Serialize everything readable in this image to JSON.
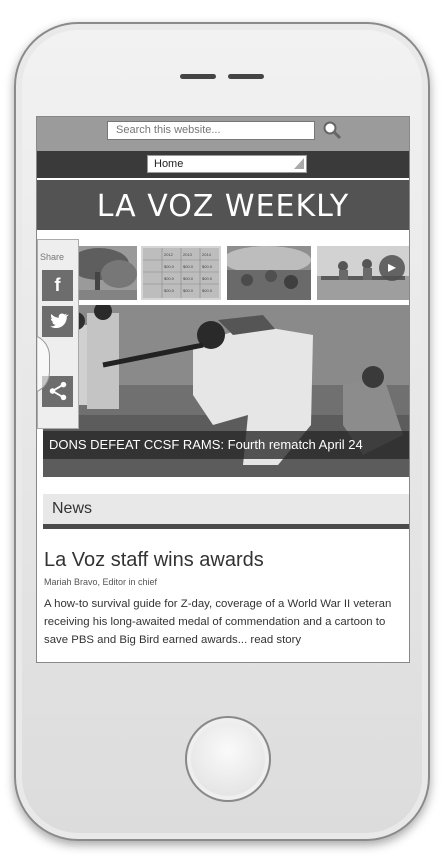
{
  "search": {
    "placeholder": "Search this website..."
  },
  "nav": {
    "selected": "Home"
  },
  "site": {
    "title": "LA VOZ WEEKLY"
  },
  "share": {
    "label": "Share",
    "facebook": "f"
  },
  "hero": {
    "caption": "DONS DEFEAT CCSF RAMS: Fourth rematch April 24"
  },
  "news": {
    "section_title": "News",
    "article": {
      "title": "La Voz staff wins awards",
      "byline": "Mariah Bravo, Editor in chief",
      "excerpt": "A how-to survival guide for Z-day, coverage of a World War II veteran receiving his long-awaited medal of commendation and a cartoon to save PBS and Big Bird earned awards... read story"
    }
  },
  "table_thumb": {
    "cells": [
      [
        "",
        "2012",
        "2013",
        "2014"
      ],
      [
        "",
        "$00.0",
        "$00.0",
        "$00.0"
      ],
      [
        "",
        "$00.0",
        "$00.0",
        "$00.0"
      ],
      [
        "",
        "$00.0",
        "$00.0",
        "$00.0"
      ]
    ]
  }
}
